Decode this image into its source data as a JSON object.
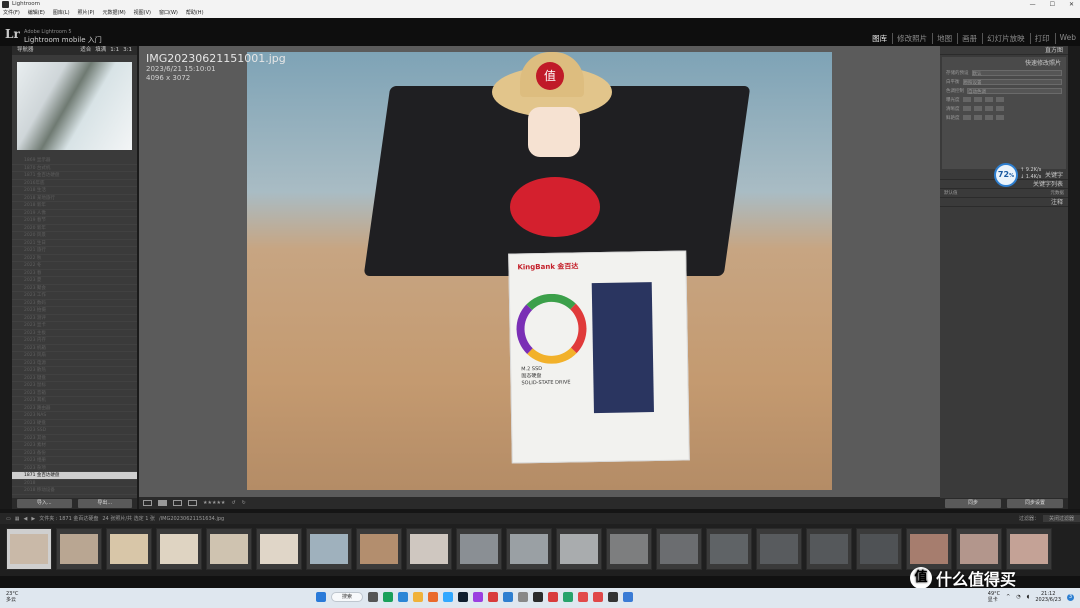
{
  "window": {
    "title": "Lightroom",
    "min": "—",
    "max": "☐",
    "close": "✕"
  },
  "menu": [
    "文件(F)",
    "编辑(E)",
    "图库(L)",
    "照片(P)",
    "元数据(M)",
    "视图(V)",
    "窗口(W)",
    "帮助(H)"
  ],
  "identity": {
    "logo": "Lr",
    "adobe": "Adobe Lightroom 5",
    "catalog": "Lightroom mobile 入门"
  },
  "modules": [
    "图库",
    "修改照片",
    "地图",
    "画册",
    "幻灯片放映",
    "打印",
    "Web"
  ],
  "left_panel": {
    "navigator_label": "导航器",
    "navigator_zoom": [
      "适合",
      "填满",
      "1:1",
      "3:1"
    ],
    "folders": [
      "1869 显示器",
      "1870 台式机",
      "1871 金百达硬盘",
      "2016年底",
      "2018 生活",
      "2018 某地旅行",
      "2018 新年",
      "2019 人像",
      "2019 春节",
      "2020 新年",
      "2020 风景",
      "2021 生日",
      "2021 旅行",
      "2022 秋",
      "2022 冬",
      "2023 春",
      "2023 夏",
      "2023 聚会",
      "2023 工作",
      "2023 数码",
      "2023 拍摄",
      "2023 测评",
      "2023 显卡",
      "2023 主板",
      "2023 内存",
      "2023 机箱",
      "2023 风扇",
      "2023 电源",
      "2023 散热",
      "2023 键盘",
      "2023 鼠标",
      "2023 音箱",
      "2023 耳机",
      "2023 路由器",
      "2023 NAS",
      "2023 硬盘",
      "2023 SSD",
      "2023 其他",
      "2023 素材",
      "2023 备份",
      "2023 相册",
      "2023 杂项",
      "1871 金百达硬盘",
      "2018",
      "2018 移动设备"
    ],
    "selected_folder": "1871 金百达硬盘",
    "import_button": "导入...",
    "export_button": "导出..."
  },
  "photo": {
    "filename": "IMG20230621151001.jpg",
    "datetime": "2023/6/21 15:10:01",
    "dimensions": "4096 x 3072",
    "badge_char": "值",
    "box_brand": "KingBank 金百达",
    "box_line1": "M.2 SSD",
    "box_line2": "固态硬盘",
    "box_line3": "SOLID-STATE DRIVE"
  },
  "toolbar": {
    "rating": "★★★★★"
  },
  "right_panel": {
    "histogram": "直方图",
    "quick_develop": "快速修改照片",
    "rows": [
      {
        "label": "存储的预设",
        "value": "默认"
      },
      {
        "label": "白平衡",
        "value": "原照设置"
      },
      {
        "label": "色调控制",
        "value": "自动色调"
      }
    ],
    "sub_rows": [
      "曝光度",
      "清晰度",
      "鲜艳度"
    ],
    "keywords_tag": "关键字",
    "keyword_list": "关键字列表",
    "metadata_preset": "默认值",
    "metadata": "元数据",
    "comments": "注释",
    "sync_button": "同步",
    "sync_settings_button": "同步设置"
  },
  "speed_meter": {
    "percent": "72",
    "unit": "%",
    "up": "9.2K/s",
    "down": "1.4K/s"
  },
  "filmbar": {
    "info": "文件夹 : 1871 金百达硬盘",
    "count": "24 张照片/共 选定 1 张",
    "current": "/IMG20230621151634.jpg",
    "filter_label": "过滤器：",
    "filter_value": "关闭过滤器"
  },
  "watermark": {
    "circle": "值",
    "text": "什么值得买"
  },
  "taskbar": {
    "temp": "23°C",
    "weather": "多云",
    "search": "搜索",
    "sys_temp": "49°C",
    "sys_label": "显卡",
    "time": "21:12",
    "date": "2023/6/23",
    "notif": "3"
  },
  "colors": {
    "accent": "#2e7fd0",
    "badge": "#c01a28"
  }
}
